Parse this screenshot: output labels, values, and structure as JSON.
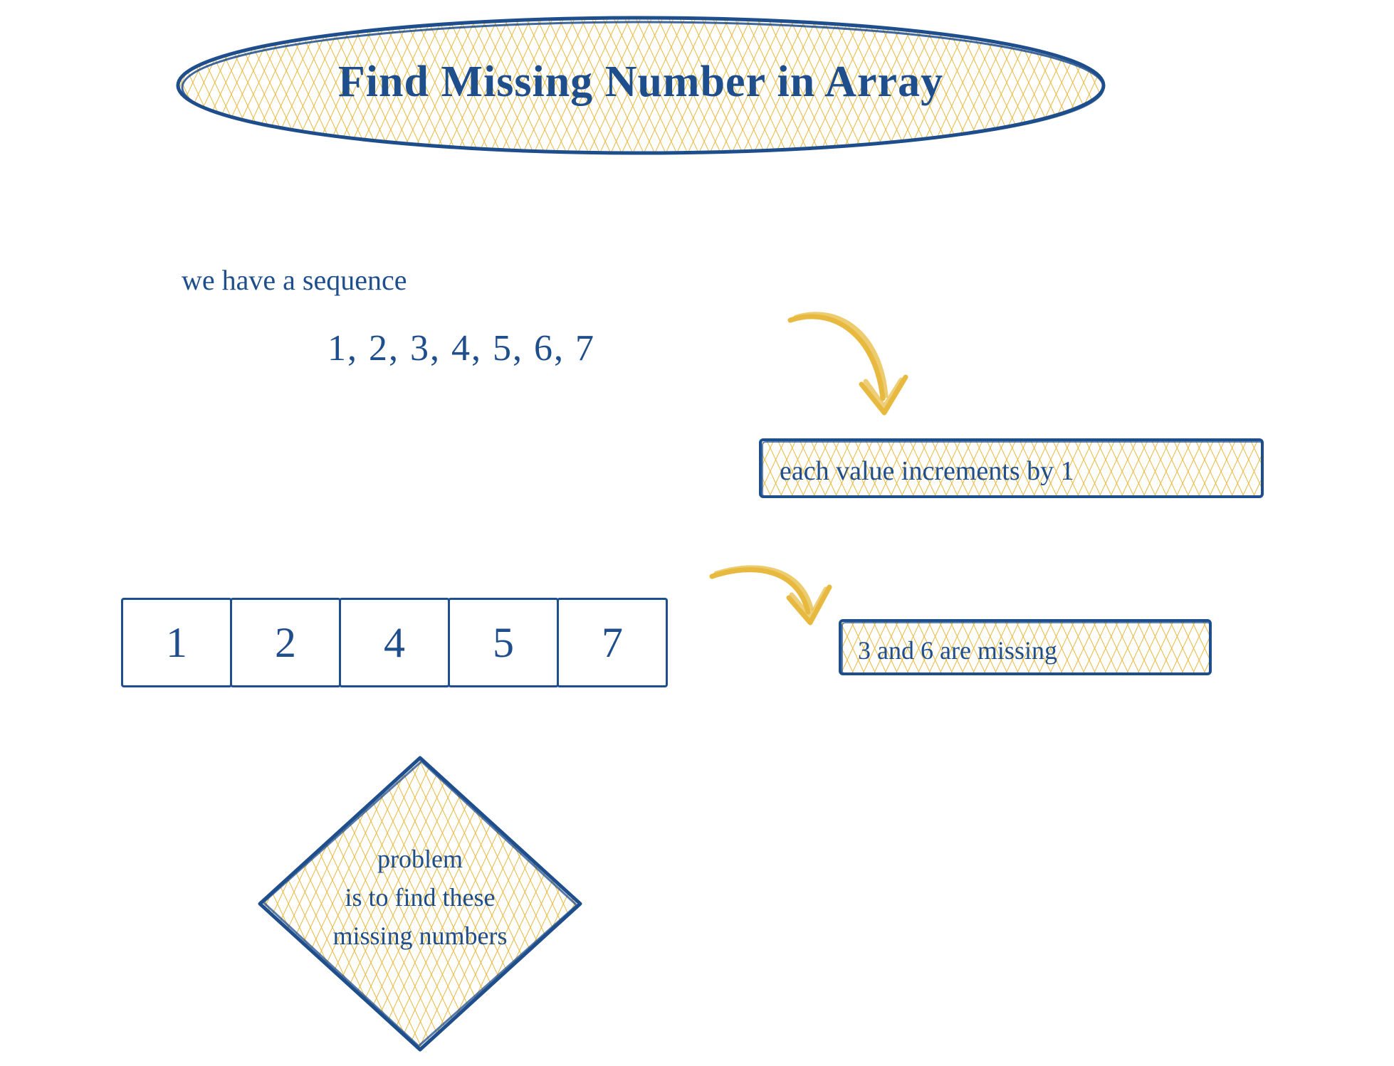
{
  "title": "Find Missing Number in Array",
  "seq_label": "we have a sequence",
  "sequence": "1, 2, 3, 4, 5, 6, 7",
  "note_increment": "each value increments by 1",
  "array_cells": [
    "1",
    "2",
    "4",
    "5",
    "7"
  ],
  "note_missing": "3 and 6 are missing",
  "problem_line1": "problem",
  "problem_line2": "is to find these",
  "problem_line3": "missing numbers",
  "colors": {
    "ink": "#1f4e8c",
    "hatch": "#e7b93f"
  }
}
